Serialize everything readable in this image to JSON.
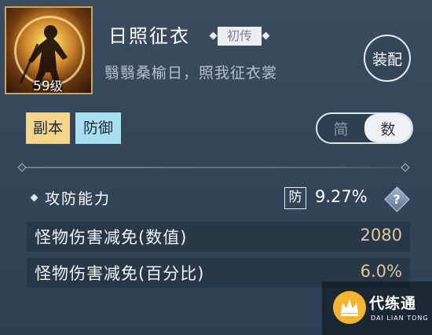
{
  "item": {
    "name": "日照征衣",
    "rarity": "初传",
    "description": "翳翳桑榆日，照我征衣裳",
    "level_number": "59",
    "level_suffix": "级"
  },
  "actions": {
    "equip_label": "装配"
  },
  "tags": {
    "dungeon": "副本",
    "defense": "防御"
  },
  "view_toggle": {
    "simple_label": "简",
    "numeric_label": "数",
    "selected": "数"
  },
  "section": {
    "title": "攻防能力",
    "badge": "防",
    "value": "9.27%",
    "help_icon": "question-icon"
  },
  "stats": [
    {
      "name": "怪物伤害减免(数值)",
      "value": "2080"
    },
    {
      "name": "怪物伤害减免(百分比)",
      "value": "6.0%"
    }
  ],
  "watermark": {
    "name": "代练通",
    "subtitle": "DAI LIAN TONG",
    "icon": "crown-logo-icon"
  },
  "colors": {
    "dungeon_tag": "#f4d58e",
    "defense_tag": "#a8dff0",
    "stat_value": "#e2c69a",
    "portrait_border": "#caa45c"
  }
}
